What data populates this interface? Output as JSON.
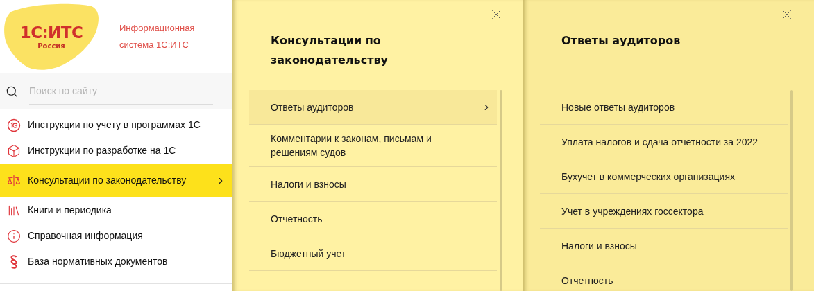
{
  "sidebar": {
    "logo": {
      "mark": "1С:ИТС",
      "region": "Россия"
    },
    "tagline": "Информационная система 1С:ИТС",
    "search": {
      "placeholder": "Поиск по сайту"
    },
    "items": [
      {
        "label": "Инструкции по учету в программах 1С",
        "selected": false
      },
      {
        "label": "Инструкции по разработке на 1С",
        "selected": false
      },
      {
        "label": "Консультации по законодательству",
        "selected": true
      },
      {
        "label": "Книги и периодика",
        "selected": false
      },
      {
        "label": "Справочная информация",
        "selected": false
      },
      {
        "label": "База нормативных документов",
        "selected": false
      }
    ]
  },
  "panels": [
    {
      "title": "Консультации по законодательству",
      "items": [
        {
          "label": "Ответы аудиторов",
          "selected": true
        },
        {
          "label": "Комментарии к законам, письмам и решениям судов",
          "selected": false
        },
        {
          "label": "Налоги и взносы",
          "selected": false
        },
        {
          "label": "Отчетность",
          "selected": false
        },
        {
          "label": "Бюджетный учет",
          "selected": false
        }
      ]
    },
    {
      "title": "Ответы аудиторов",
      "items": [
        {
          "label": "Новые ответы аудиторов",
          "selected": false
        },
        {
          "label": "Уплата налогов и сдача отчетности за 2022",
          "selected": false
        },
        {
          "label": "Бухучет в коммерческих организациях",
          "selected": false
        },
        {
          "label": "Учет в учреждениях госсектора",
          "selected": false
        },
        {
          "label": "Налоги и взносы",
          "selected": false
        },
        {
          "label": "Отчетность",
          "selected": false
        }
      ]
    }
  ]
}
